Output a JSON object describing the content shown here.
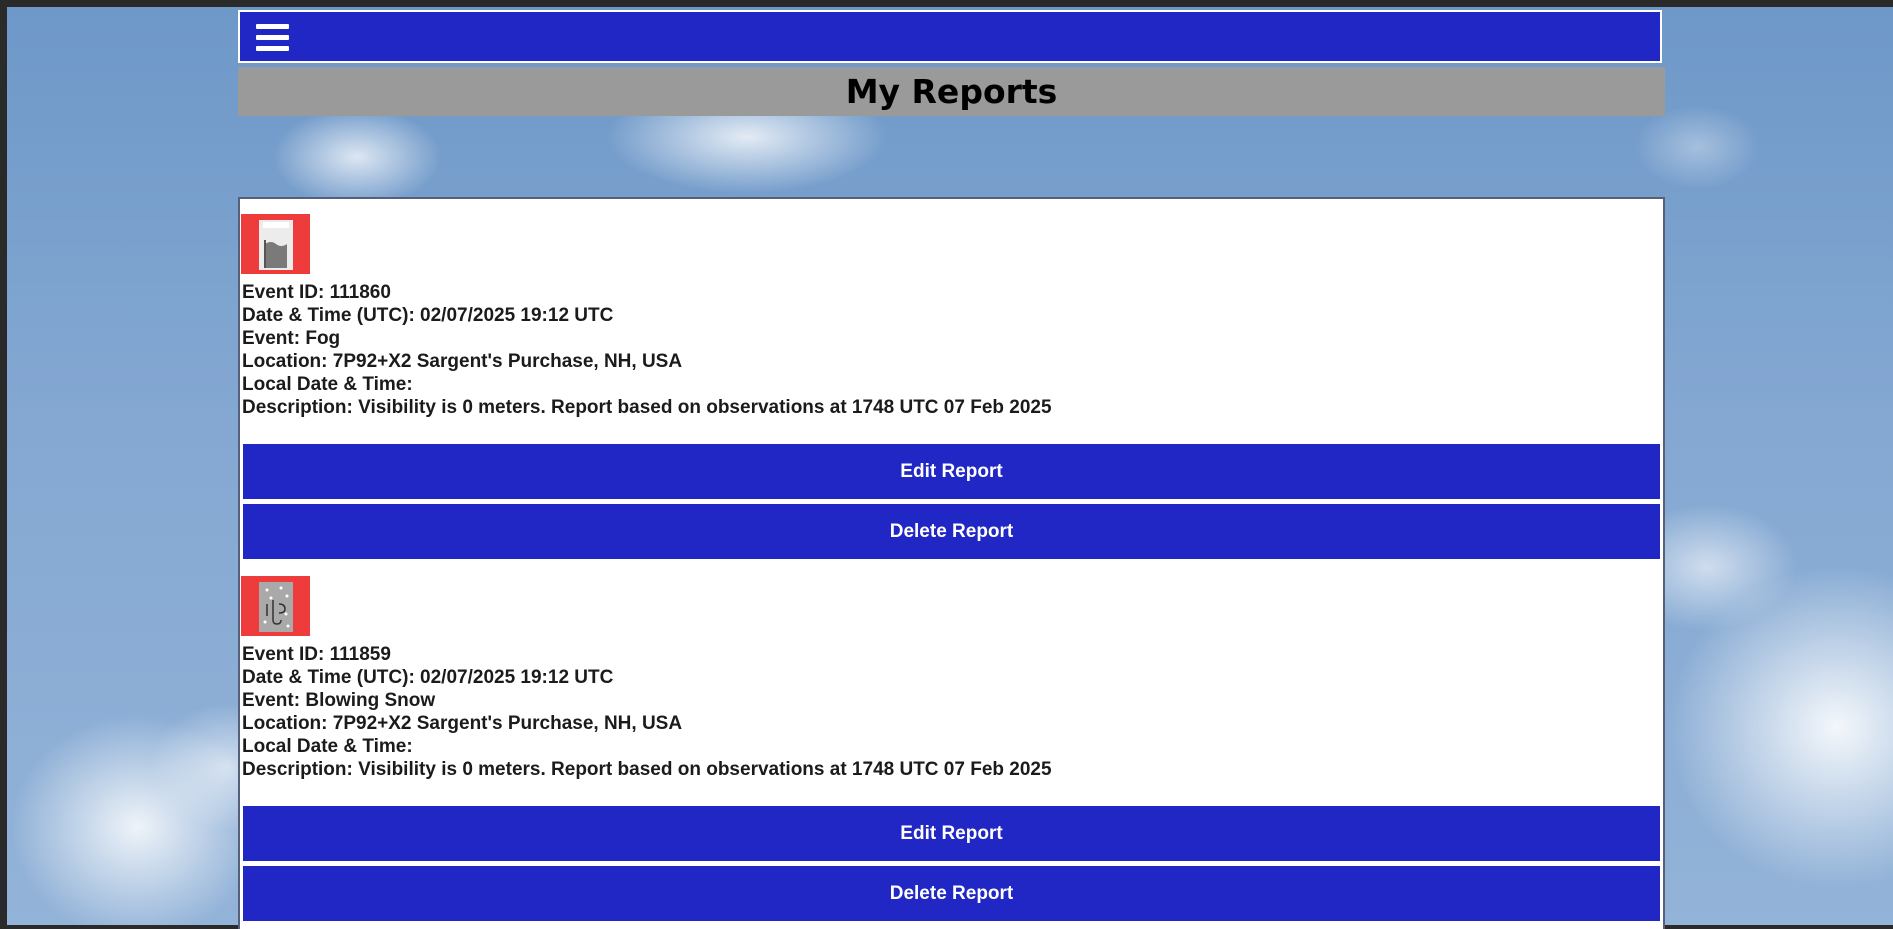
{
  "page": {
    "title": "My Reports"
  },
  "nav": {
    "menu_icon": "hamburger-menu-icon"
  },
  "colors": {
    "nav_bg": "#2027c4",
    "title_bg": "#9a9a9a",
    "button_bg": "#2027c4",
    "icon_bg": "#ee3b3b"
  },
  "reports": [
    {
      "icon": "fog-icon",
      "event_id": "Event ID: 111860",
      "datetime_utc": "Date & Time (UTC): 02/07/2025 19:12 UTC",
      "event": "Event: Fog",
      "location": "Location: 7P92+X2 Sargent's Purchase, NH, USA",
      "local_datetime": "Local Date & Time:",
      "description": "Description: Visibility is 0 meters. Report based on observations at 1748 UTC 07 Feb 2025",
      "edit_label": "Edit Report",
      "delete_label": "Delete Report"
    },
    {
      "icon": "blowing-snow-icon",
      "event_id": "Event ID: 111859",
      "datetime_utc": "Date & Time (UTC): 02/07/2025 19:12 UTC",
      "event": "Event: Blowing Snow",
      "location": "Location: 7P92+X2 Sargent's Purchase, NH, USA",
      "local_datetime": "Local Date & Time:",
      "description": "Description: Visibility is 0 meters. Report based on observations at 1748 UTC 07 Feb 2025",
      "edit_label": "Edit Report",
      "delete_label": "Delete Report"
    }
  ]
}
